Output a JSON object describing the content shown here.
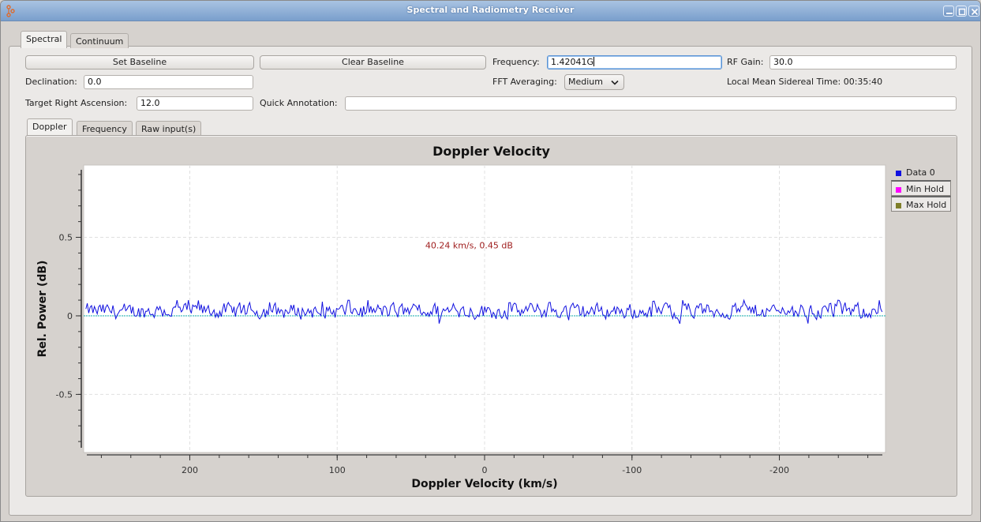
{
  "window": {
    "title": "Spectral and Radiometry Receiver",
    "buttons": [
      "minimize",
      "maximize",
      "close"
    ]
  },
  "main_tabs": [
    {
      "label": "Spectral",
      "active": true
    },
    {
      "label": "Continuum",
      "active": false
    }
  ],
  "controls": {
    "set_baseline_label": "Set Baseline",
    "clear_baseline_label": "Clear Baseline",
    "frequency_label": "Frequency:",
    "frequency_value": "1.42041G",
    "rf_gain_label": "RF Gain:",
    "rf_gain_value": "30.0",
    "declination_label": "Declination:",
    "declination_value": "0.0",
    "fft_averaging_label": "FFT Averaging:",
    "fft_averaging_value": "Medium",
    "lmst_label": "Local Mean Sidereal Time: 00:35:40",
    "target_ra_label": "Target Right Ascension:",
    "target_ra_value": "12.0",
    "quick_annotation_label": "Quick Annotation:",
    "quick_annotation_value": ""
  },
  "plot_tabs": [
    {
      "label": "Doppler",
      "active": true
    },
    {
      "label": "Frequency",
      "active": false
    },
    {
      "label": "Raw input(s)",
      "active": false
    }
  ],
  "colors": {
    "data0": "#1010e0",
    "min_hold": "#ff00ff",
    "max_hold": "#7f7f2a",
    "baseline": "#2bb8b8",
    "annotation": "#a02020"
  },
  "chart_data": {
    "type": "line",
    "title": "Doppler Velocity",
    "xlabel": "Doppler Velocity (km/s)",
    "ylabel": "Rel. Power (dB)",
    "xlim": [
      272,
      -272
    ],
    "ylim": [
      -0.87,
      0.96
    ],
    "x_reversed": true,
    "x_ticks": [
      200,
      100,
      0,
      -100,
      -200
    ],
    "x_tick_labels": [
      "200",
      "100",
      "0",
      "-100",
      "-200"
    ],
    "x_minor_step": 20,
    "y_ticks": [
      0.5,
      0,
      -0.5
    ],
    "y_tick_labels": [
      "0.5",
      "0",
      "-0.5"
    ],
    "y_minor_step": 0.1,
    "grid": true,
    "legend": {
      "placement": "right",
      "entries": [
        "Data 0",
        "Min Hold",
        "Max Hold"
      ]
    },
    "annotation": {
      "text": "40.24 km/s, 0.45 dB",
      "x": 40.24,
      "y": 0.45
    },
    "series": [
      {
        "name": "Data 0",
        "description": "noise around ~0.03 dB, range approx -0.05 to 0.1 dB",
        "mean": 0.03,
        "min": -0.05,
        "max": 0.1
      },
      {
        "name": "Baseline",
        "description": "flat line at 0 dB",
        "values_constant": 0
      }
    ]
  }
}
